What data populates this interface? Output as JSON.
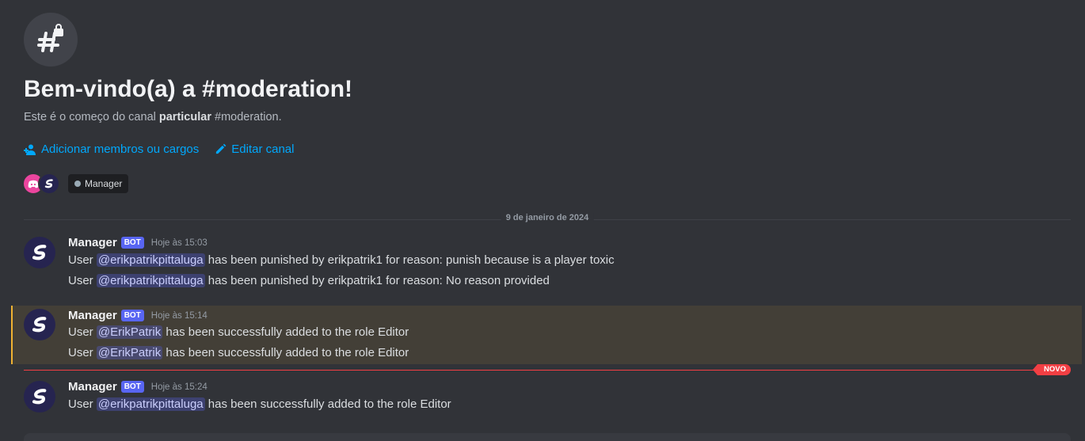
{
  "welcome": {
    "title": "Bem-vindo(a) a #moderation!",
    "subtitle_prefix": "Este é o começo do canal ",
    "subtitle_bold": "particular",
    "subtitle_suffix": " #moderation.",
    "add_members": "Adicionar membros ou cargos",
    "edit_channel": "Editar canal",
    "role_pill": "Manager"
  },
  "date_divider": "9 de janeiro de 2024",
  "new_badge": "NOVO",
  "bot_tag": "BOT",
  "messages": [
    {
      "username": "Manager",
      "time": "Hoje às 15:03",
      "lines": [
        {
          "prefix": "User ",
          "mention": "@erikpatrikpittaluga",
          "suffix": " has been punished by erikpatrik1 for reason: punish because is a player toxic"
        },
        {
          "prefix": "User ",
          "mention": "@erikpatrikpittaluga",
          "suffix": " has been punished by erikpatrik1 for reason: No reason provided"
        }
      ]
    },
    {
      "username": "Manager",
      "time": "Hoje às 15:14",
      "lines": [
        {
          "prefix": "User ",
          "mention": "@ErikPatrik",
          "suffix": " has been successfully added to the role Editor"
        },
        {
          "prefix": "User ",
          "mention": "@ErikPatrik",
          "suffix": " has been successfully added to the role Editor"
        }
      ]
    },
    {
      "username": "Manager",
      "time": "Hoje às 15:24",
      "lines": [
        {
          "prefix": "User ",
          "mention": "@erikpatrikpittaluga",
          "suffix": " has been successfully added to the role Editor"
        }
      ]
    }
  ],
  "colors": {
    "background": "#313338",
    "link": "#00a8fc",
    "bot_tag": "#5865f2",
    "highlight": "#433f37",
    "highlight_border": "#f0b232",
    "new_divider": "#f23f43"
  }
}
